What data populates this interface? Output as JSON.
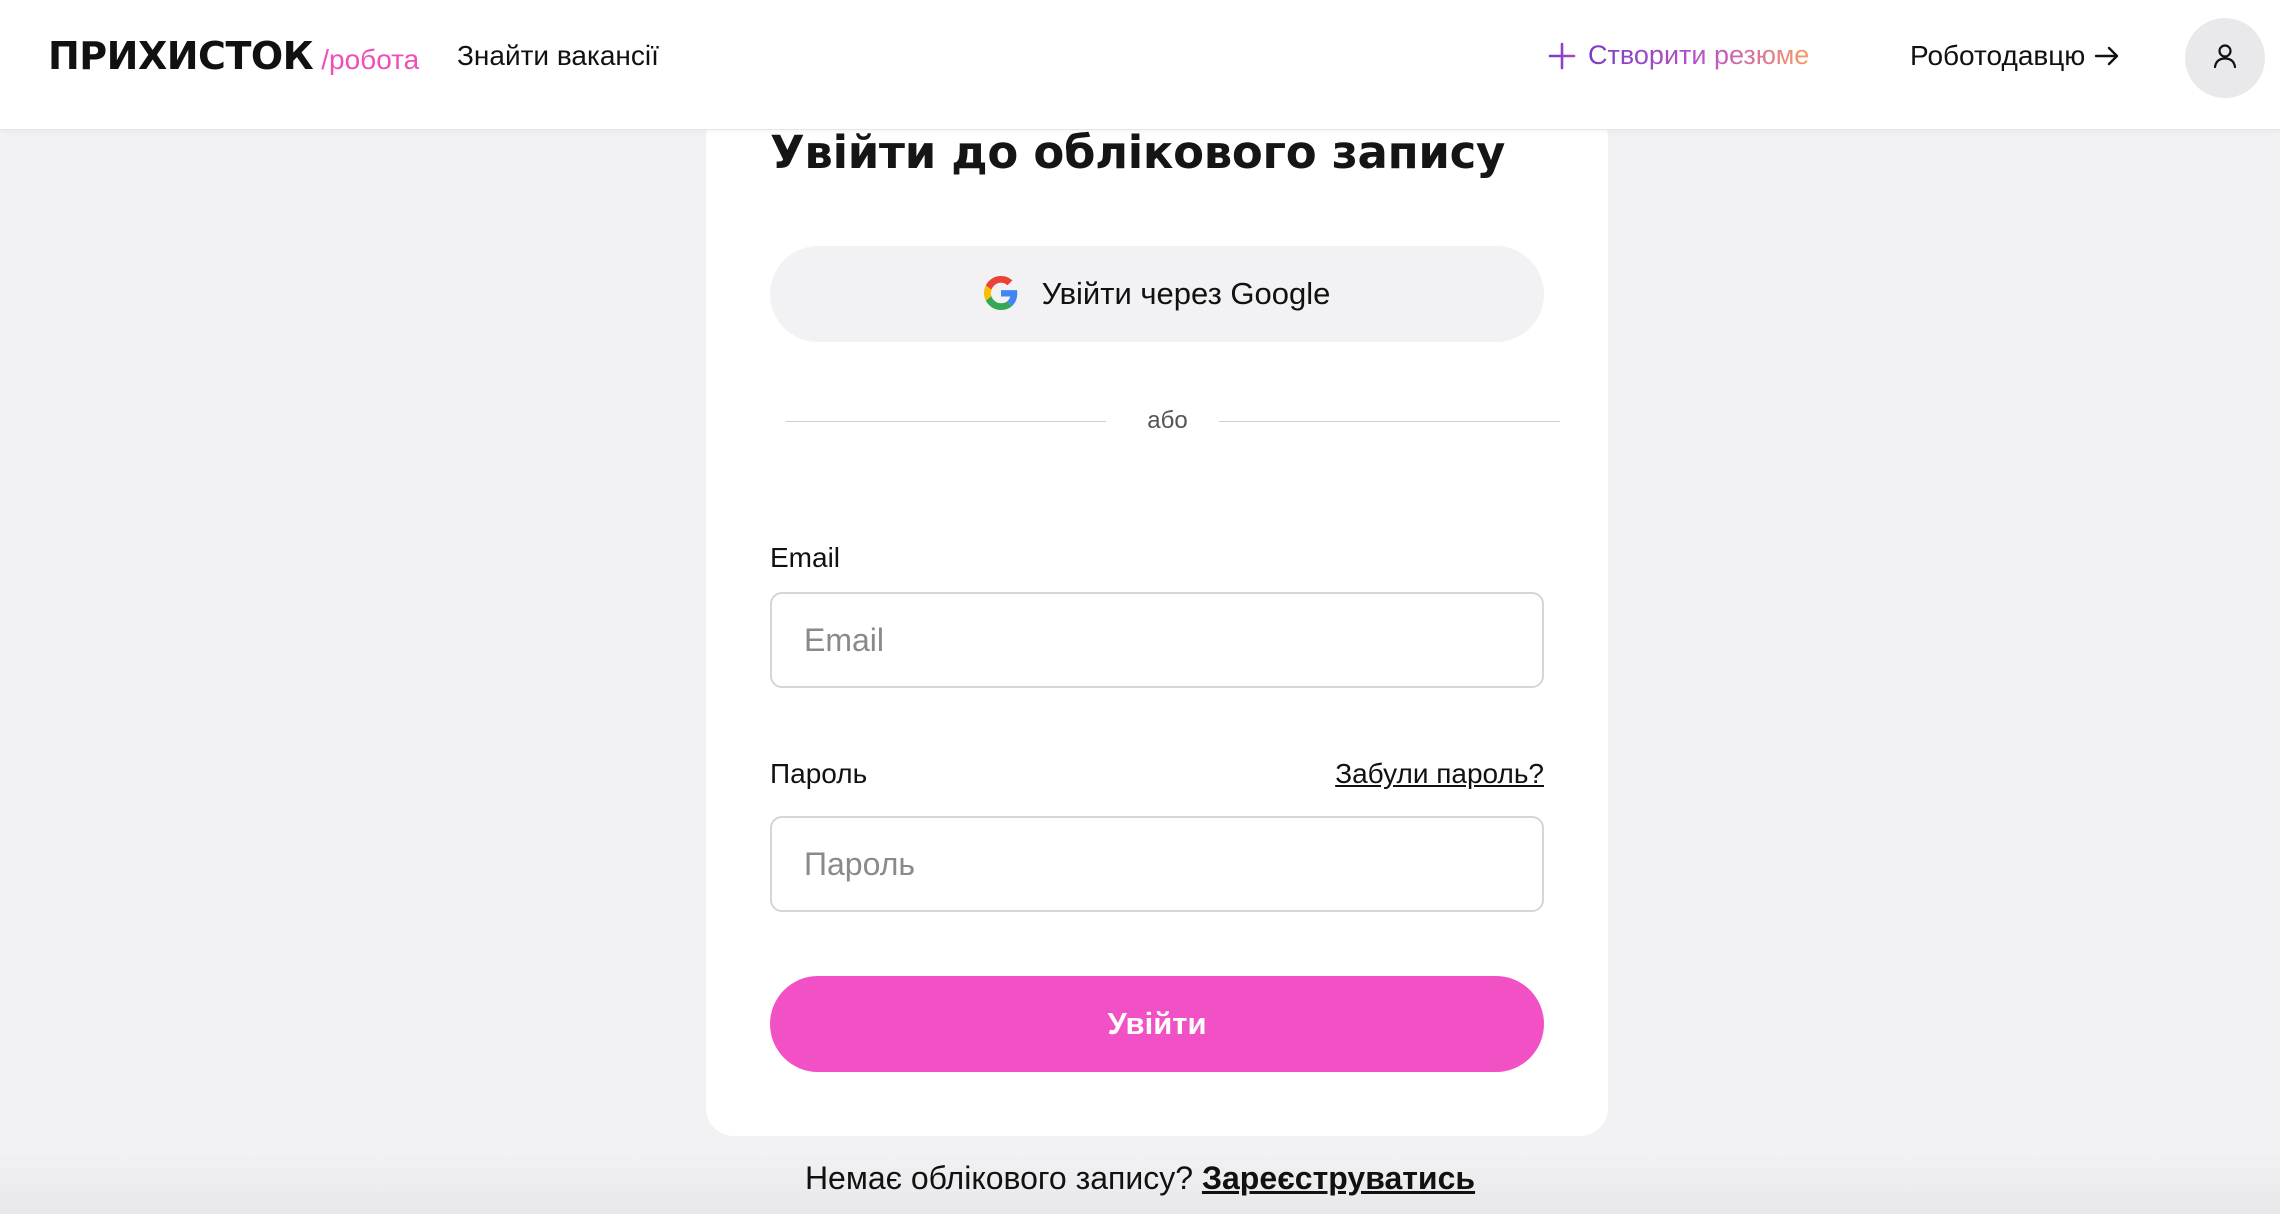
{
  "header": {
    "logo_main": "ПРИХИСТОК",
    "logo_sub": "/робота",
    "find_jobs": "Знайти вакансії",
    "create_resume": "Створити резюме",
    "employer": "Роботодавцю"
  },
  "login": {
    "title": "Увійти до облікового запису",
    "google_button": "Увійти через Google",
    "divider": "або",
    "email_label": "Email",
    "email_placeholder": "Email",
    "email_value": "",
    "password_label": "Пароль",
    "password_placeholder": "Пароль",
    "password_value": "",
    "forgot_password": "Забули пароль?",
    "submit": "Увійти"
  },
  "footer": {
    "no_account": "Немає облікового запису?",
    "register": "Зареєструватись"
  },
  "colors": {
    "brand_pink": "#f251c5",
    "logo_accent": "#ee4fb9",
    "resume_gradient_start": "#7a3cc8",
    "resume_gradient_end": "#f59a62",
    "page_background": "#f2f2f4"
  },
  "icons": {
    "create_resume": "plus-icon",
    "employer": "arrow-right-icon",
    "profile": "user-icon",
    "google": "google-icon"
  }
}
